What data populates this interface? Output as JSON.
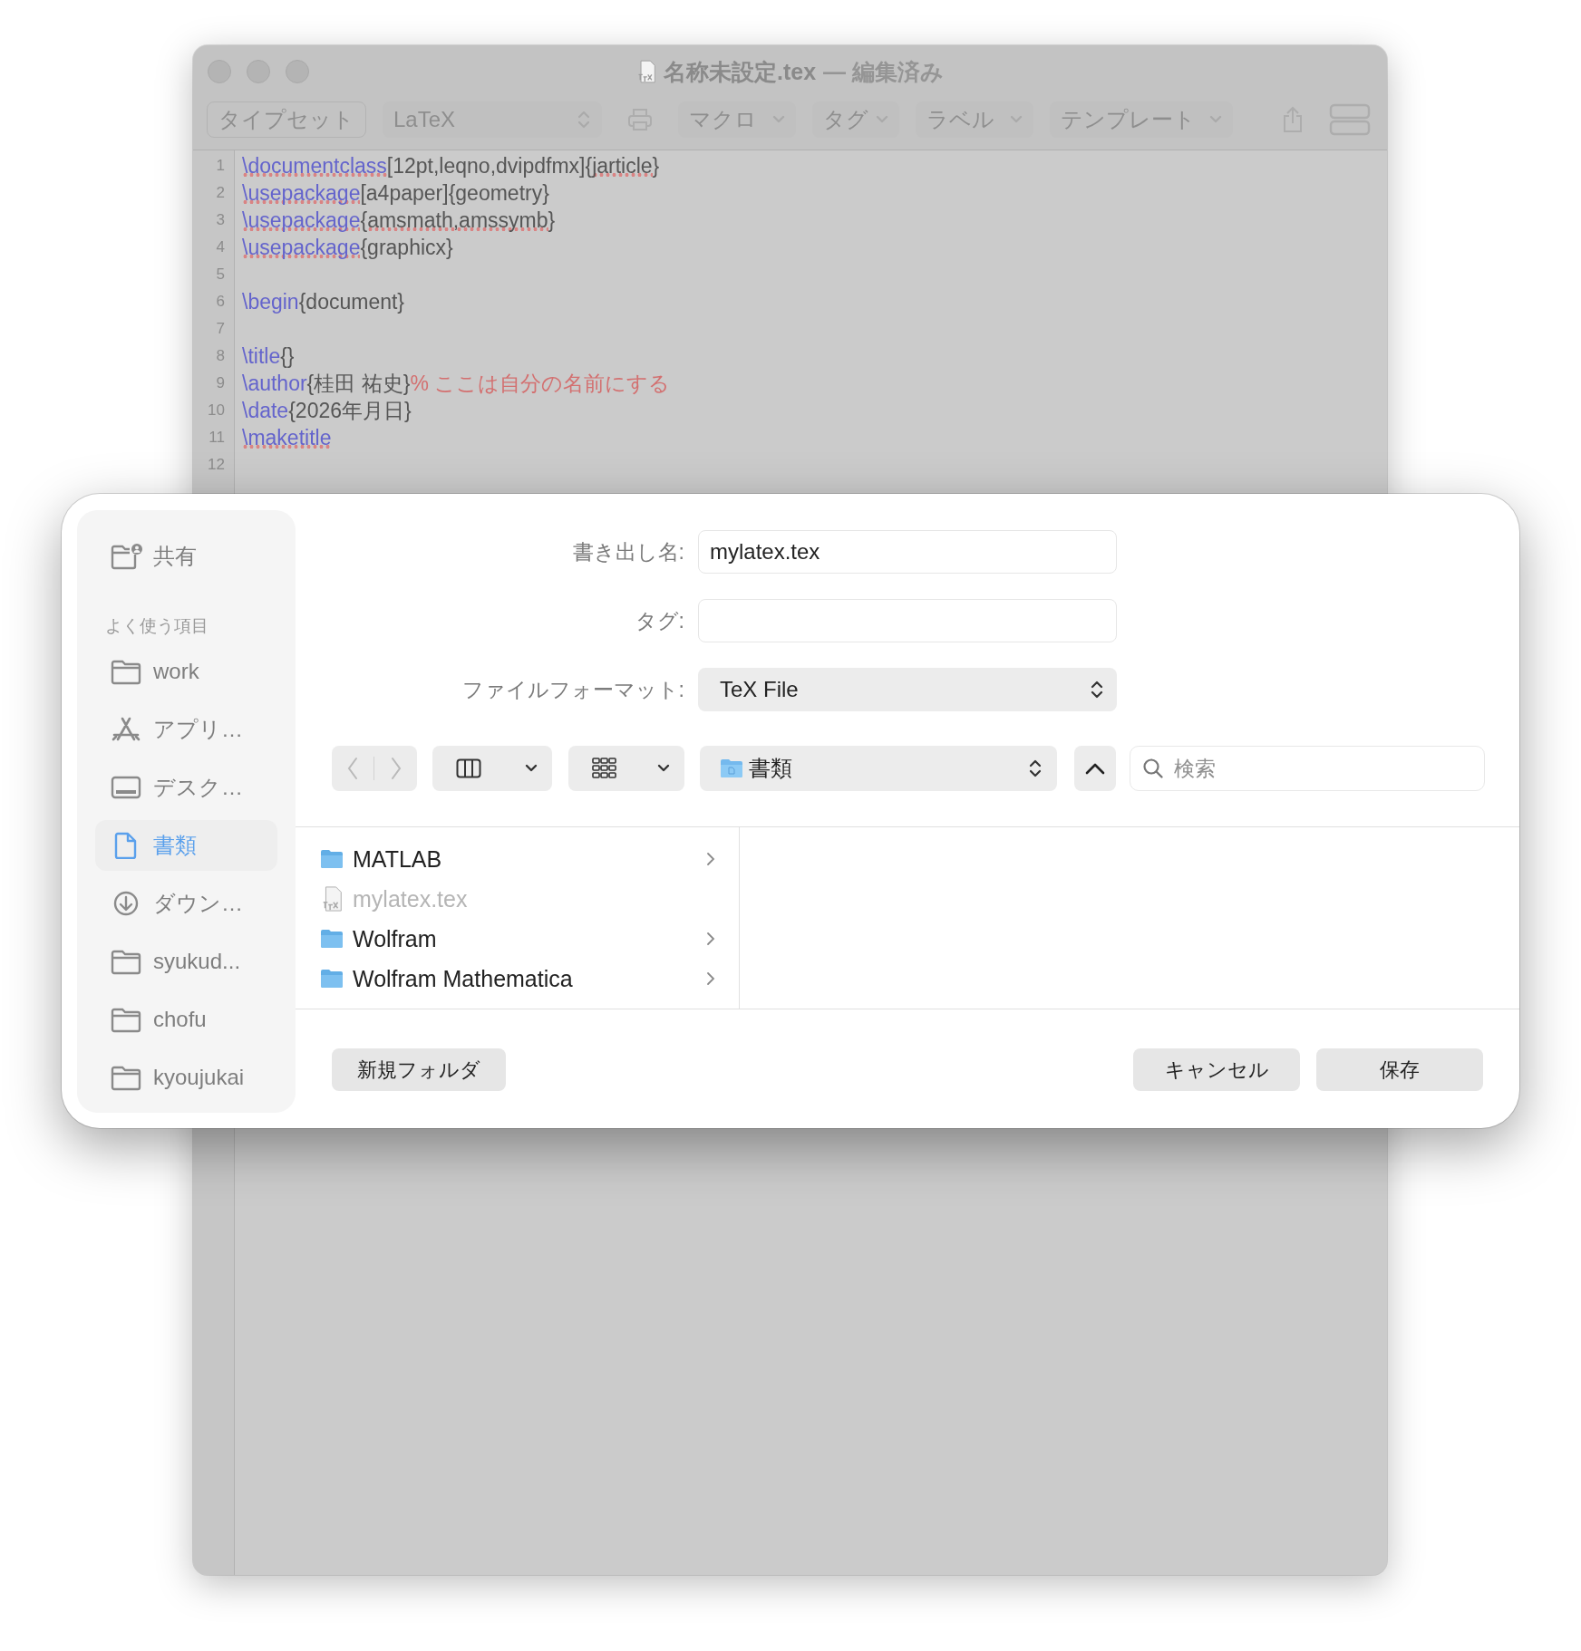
{
  "editor_window": {
    "title": "名称未設定.tex",
    "status": "— 編集済み",
    "toolbar": [
      {
        "kind": "button",
        "label": "タイプセット"
      },
      {
        "kind": "popup",
        "label": "LaTeX"
      },
      {
        "kind": "print"
      },
      {
        "kind": "pulldown",
        "label": "マクロ"
      },
      {
        "kind": "pulldown",
        "label": "タグ"
      },
      {
        "kind": "pulldown",
        "label": "ラベル"
      },
      {
        "kind": "pulldown",
        "label": "テンプレート"
      },
      {
        "kind": "share"
      },
      {
        "kind": "split"
      }
    ],
    "lines": [
      {
        "number": "1",
        "segments": [
          {
            "kind": "command",
            "text": "\\documentclass",
            "misspelled": true
          },
          {
            "kind": "text",
            "text": "[12pt,leqno,dvipdfmx]{",
            "misspelled": false
          },
          {
            "kind": "text",
            "text": "jarticle",
            "misspelled": true
          },
          {
            "kind": "text",
            "text": "}",
            "misspelled": false
          }
        ]
      },
      {
        "number": "2",
        "segments": [
          {
            "kind": "command",
            "text": "\\usepackage",
            "misspelled": true
          },
          {
            "kind": "text",
            "text": "[a4paper]{geometry}",
            "misspelled": false
          }
        ]
      },
      {
        "number": "3",
        "segments": [
          {
            "kind": "command",
            "text": "\\usepackage",
            "misspelled": true
          },
          {
            "kind": "text",
            "text": "{",
            "misspelled": false
          },
          {
            "kind": "text",
            "text": "amsmath,amssymb",
            "misspelled": true
          },
          {
            "kind": "text",
            "text": "}",
            "misspelled": false
          }
        ]
      },
      {
        "number": "4",
        "segments": [
          {
            "kind": "command",
            "text": "\\usepackage",
            "misspelled": true
          },
          {
            "kind": "text",
            "text": "{graphicx}",
            "misspelled": false
          }
        ]
      },
      {
        "number": "5"
      },
      {
        "number": "6",
        "segments": [
          {
            "kind": "command",
            "text": "\\begin",
            "misspelled": false
          },
          {
            "kind": "text",
            "text": "{document}",
            "misspelled": false
          }
        ]
      },
      {
        "number": "7"
      },
      {
        "number": "8",
        "segments": [
          {
            "kind": "command",
            "text": "\\title",
            "misspelled": false
          },
          {
            "kind": "text",
            "text": "{}",
            "misspelled": false
          }
        ]
      },
      {
        "number": "9",
        "segments": [
          {
            "kind": "command",
            "text": "\\author",
            "misspelled": false
          },
          {
            "kind": "text",
            "text": "{桂田 祐史}",
            "misspelled": false
          },
          {
            "kind": "comment",
            "text": "% ここは自分の名前にする",
            "misspelled": false
          }
        ]
      },
      {
        "number": "10",
        "segments": [
          {
            "kind": "command",
            "text": "\\date",
            "misspelled": false
          },
          {
            "kind": "text",
            "text": "{2026年月日}",
            "misspelled": false
          }
        ]
      },
      {
        "number": "11",
        "segments": [
          {
            "kind": "command",
            "text": "\\maketitle",
            "misspelled": true
          }
        ]
      },
      {
        "number": "12"
      }
    ]
  },
  "save_dialog": {
    "sidebar": {
      "top_items": [
        {
          "kind": "shared",
          "label": "共有",
          "selected": false
        }
      ],
      "section_header": "よく使う項目",
      "items": [
        {
          "kind": "folder",
          "label": "work",
          "selected": false
        },
        {
          "kind": "apps",
          "label": "アプリ…",
          "selected": false
        },
        {
          "kind": "desktop",
          "label": "デスク…",
          "selected": false
        },
        {
          "kind": "documents",
          "label": "書類",
          "selected": true
        },
        {
          "kind": "downloads",
          "label": "ダウン…",
          "selected": false
        },
        {
          "kind": "folder",
          "label": "syukud...",
          "selected": false
        },
        {
          "kind": "folder",
          "label": "chofu",
          "selected": false
        },
        {
          "kind": "folder",
          "label": "kyoujukai",
          "selected": false
        }
      ]
    },
    "export_name": {
      "label": "書き出し名:",
      "value": "mylatex.tex"
    },
    "tags": {
      "label": "タグ:"
    },
    "file_format": {
      "label": "ファイルフォーマット:",
      "value": "TeX File"
    },
    "navigation": {
      "back_disabled": true,
      "forward_disabled": true
    },
    "location": "書類",
    "search": {
      "placeholder": "検索"
    },
    "files": [
      {
        "kind": "folder",
        "name": "MATLAB",
        "disabled": false
      },
      {
        "kind": "tex",
        "name": "mylatex.tex",
        "disabled": true
      },
      {
        "kind": "folder",
        "name": "Wolfram",
        "disabled": false
      },
      {
        "kind": "folder",
        "name": "Wolfram Mathematica",
        "disabled": false
      }
    ],
    "left_buttons": [
      "新規フォルダ"
    ],
    "right_buttons": [
      "キャンセル",
      "保存"
    ]
  }
}
